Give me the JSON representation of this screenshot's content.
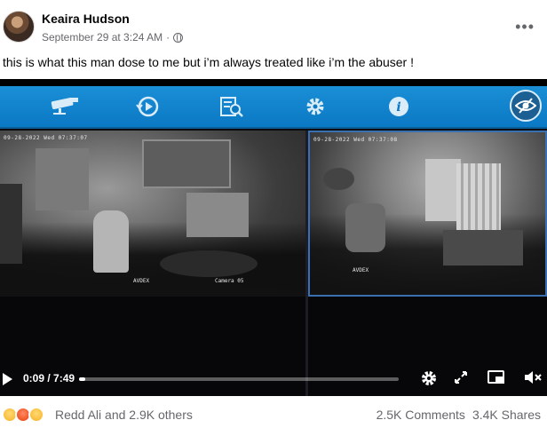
{
  "post": {
    "author": "Keaira Hudson",
    "timestamp": "September 29 at 3:24 AM",
    "separator": "·",
    "privacy_icon": "globe-icon",
    "more_label": "•••",
    "caption": "this is what this man dose to me but i’m always treated like i’m the abuser !"
  },
  "video": {
    "toolbar_icons": [
      "cctv-camera-icon",
      "playback-icon",
      "search-file-icon",
      "gear-icon",
      "info-icon",
      "eye-view-icon"
    ],
    "cam1": {
      "timestamp": "09-28-2022 Wed 07:37:07",
      "brand": "AVDEX",
      "label": "Camera 05"
    },
    "cam2": {
      "timestamp": "09-28-2022 Wed 07:37:08",
      "brand": "AVDEX"
    },
    "player": {
      "time": "0:09 / 7:49",
      "progress_fraction": 0.019,
      "icons": [
        "play-icon",
        "settings-gear-icon",
        "fullscreen-icon",
        "picture-in-picture-icon",
        "volume-muted-icon"
      ]
    }
  },
  "engagement": {
    "reactions": [
      "sad-emoji",
      "angry-emoji",
      "wow-emoji"
    ],
    "reaction_text": "Redd Ali and 2.9K others",
    "comments": "2.5K Comments",
    "shares": "3.4K Shares"
  },
  "colors": {
    "toolbar_blue": "#1a8fd6",
    "meta_gray": "#65676b",
    "video_bg": "#0a0a0f",
    "cam_border": "#3a6fb0"
  }
}
